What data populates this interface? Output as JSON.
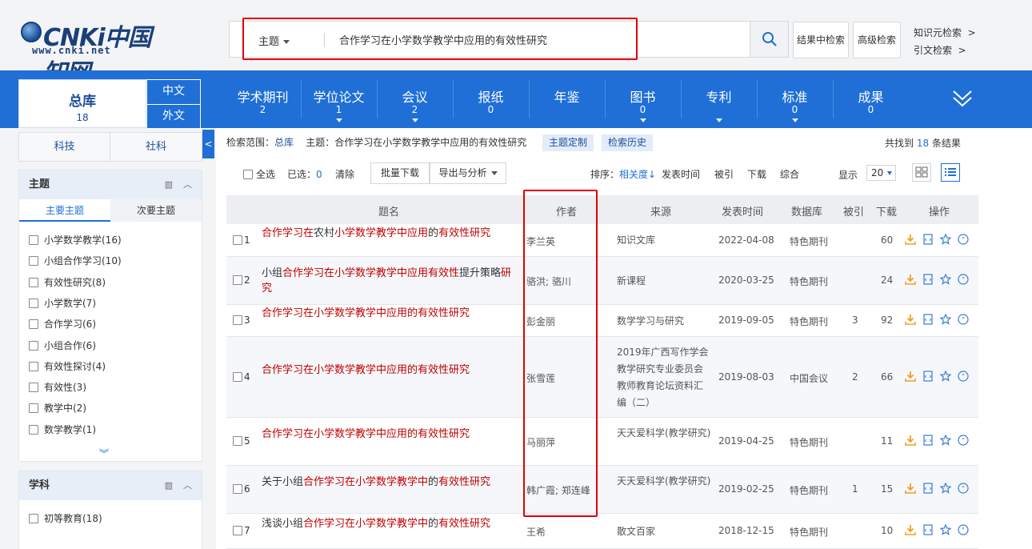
{
  "header": {
    "logo_text": "CNKi中国知网",
    "logo_url": "www.cnki.net",
    "search_type": "主题",
    "search_query": "合作学习在小学数学教学中应用的有效性研究",
    "search_in_results": "结果中检索",
    "advanced_search": "高级检索",
    "knowledge_search": "知识元检索",
    "citation_search": "引文检索",
    "arrow": ">"
  },
  "nav": {
    "total_label": "总库",
    "total_count": "18",
    "chinese": "中文",
    "foreign": "外文",
    "items": [
      {
        "name": "学术期刊",
        "count": "2"
      },
      {
        "name": "学位论文",
        "count": "1"
      },
      {
        "name": "会议",
        "count": "2"
      },
      {
        "name": "报纸",
        "count": "0"
      },
      {
        "name": "年鉴",
        "count": ""
      },
      {
        "name": "图书",
        "count": "0"
      },
      {
        "name": "专利",
        "count": ""
      },
      {
        "name": "标准",
        "count": "0"
      },
      {
        "name": "成果",
        "count": "0"
      }
    ]
  },
  "sidebar": {
    "category_tabs": [
      "科技",
      "社科"
    ],
    "collapse_arrow": "<",
    "topic_panel": {
      "title": "主题",
      "tabs": [
        "主要主题",
        "次要主题"
      ],
      "items": [
        "小学数学教学(16)",
        "小组合作学习(10)",
        "有效性研究(8)",
        "小学数学(7)",
        "合作学习(6)",
        "小组合作(6)",
        "有效性探讨(4)",
        "有效性(3)",
        "教学中(2)",
        "数学教学(1)"
      ],
      "more": "︾"
    },
    "subject_panel": {
      "title": "学科",
      "items": [
        "初等教育(18)"
      ]
    }
  },
  "main": {
    "scope_label": "检索范围：",
    "scope_value": "总库",
    "scope_query": "主题：合作学习在小学数学教学中应用的有效性研究",
    "topic_custom": "主题定制",
    "search_history": "检索历史",
    "found_prefix": "共找到",
    "found_count": "18",
    "found_suffix": "条结果",
    "select_all": "全选",
    "selected_label": "已选：",
    "selected_count": "0",
    "clear": "清除",
    "batch_download": "批量下载",
    "export_analysis": "导出与分析",
    "sort_label": "排序：",
    "sort_relevance": "相关度",
    "sort_date": "发表时间",
    "sort_cited": "被引",
    "sort_download": "下载",
    "sort_composite": "综合",
    "show_label": "显示",
    "show_count": "20"
  },
  "table": {
    "headers": [
      "题名",
      "作者",
      "来源",
      "发表时间",
      "数据库",
      "被引",
      "下载",
      "操作"
    ],
    "rows": [
      {
        "num": "1",
        "title": [
          [
            "合作学习在",
            "h"
          ],
          [
            "农村",
            ""
          ],
          [
            "小学数学教学中应用",
            "h"
          ],
          [
            "的",
            ""
          ],
          [
            "有效性研究",
            "h"
          ]
        ],
        "author": "李兰英",
        "source": "知识文库",
        "date": "2022-04-08",
        "db": "特色期刊",
        "cited": "",
        "downloads": "60"
      },
      {
        "num": "2",
        "title": [
          [
            "小组",
            ""
          ],
          [
            "合作学习在小学数学教学中应用有效性",
            "h"
          ],
          [
            "提升策略",
            ""
          ],
          [
            "研究",
            "h"
          ]
        ],
        "author": "骆洪; 骆川",
        "source": "新课程",
        "date": "2020-03-25",
        "db": "特色期刊",
        "cited": "",
        "downloads": "24"
      },
      {
        "num": "3",
        "title": [
          [
            "合作学习在小学数学教学中应用的有效性研究",
            "h"
          ]
        ],
        "author": "彭金丽",
        "source": "数学学习与研究",
        "date": "2019-09-05",
        "db": "特色期刊",
        "cited": "3",
        "downloads": "92"
      },
      {
        "num": "4",
        "title": [
          [
            "合作学习在小学数学教学中应用的有效性研究",
            "h"
          ]
        ],
        "author": "张雪莲",
        "source": "2019年广西写作学会教学研究专业委员会教师教育论坛资料汇编（二）",
        "date": "2019-08-03",
        "db": "中国会议",
        "cited": "2",
        "downloads": "66"
      },
      {
        "num": "5",
        "title": [
          [
            "合作学习在小学数学教学中应用的有效性研究",
            "h"
          ]
        ],
        "author": "马丽萍",
        "source": "天天爱科学(教学研究)",
        "date": "2019-04-25",
        "db": "特色期刊",
        "cited": "",
        "downloads": "11"
      },
      {
        "num": "6",
        "title": [
          [
            "关于小组",
            ""
          ],
          [
            "合作学习在小学数学教学中",
            "h"
          ],
          [
            "的",
            ""
          ],
          [
            "有效性研究",
            "h"
          ]
        ],
        "author": "韩广霞; 郑连峰",
        "source": "天天爱科学(教学研究)",
        "date": "2019-02-25",
        "db": "特色期刊",
        "cited": "1",
        "downloads": "15"
      },
      {
        "num": "7",
        "title": [
          [
            "浅谈小组",
            ""
          ],
          [
            "合作学习在小学数学教学中",
            "h"
          ],
          [
            "的",
            ""
          ],
          [
            "有效性研究",
            "h"
          ]
        ],
        "author": "王希",
        "source": "散文百家",
        "date": "2018-12-15",
        "db": "特色期刊",
        "cited": "",
        "downloads": "10"
      }
    ]
  },
  "colors": {
    "nav_blue": "#1f6fd6",
    "highlight_red": "#c00000",
    "annotation_red": "#e10000",
    "download_orange": "#f0a020"
  }
}
